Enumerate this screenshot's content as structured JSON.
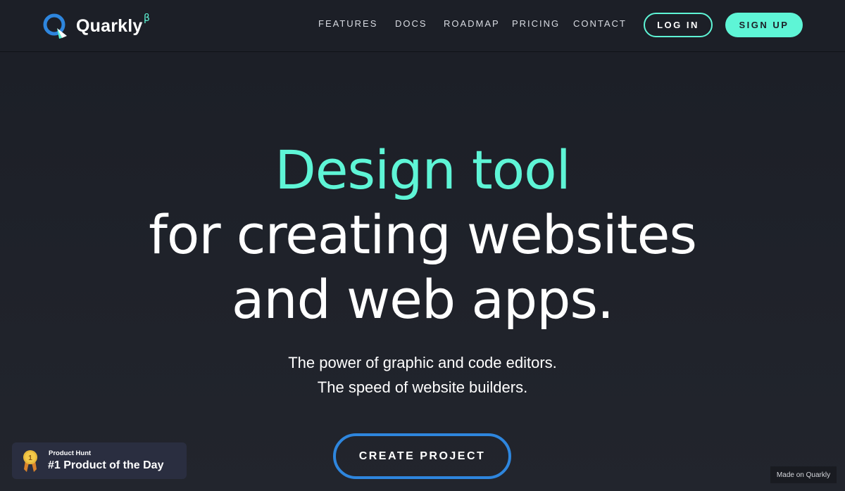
{
  "header": {
    "logo_text": "Quarkly",
    "logo_beta": "β",
    "nav": [
      "FEATURES",
      "DOCS",
      "ROADMAP",
      "PRICING",
      "CONTACT"
    ],
    "login_label": "LOG IN",
    "signup_label": "SIGN UP"
  },
  "hero": {
    "title_line1": "Design tool",
    "title_line2": "for creating websites",
    "title_line3": "and web apps.",
    "subtitle_line1": "The power of graphic and code editors.",
    "subtitle_line2": "The speed of website builders.",
    "cta_label": "CREATE PROJECT"
  },
  "product_hunt": {
    "small_label": "Product Hunt",
    "big_label": "#1 Product of the Day",
    "medal_number": "1"
  },
  "footer_badge": {
    "label": "Made on Quarkly"
  },
  "colors": {
    "accent": "#5ef5d6",
    "button_border": "#2e86de",
    "background": "#1c1f27",
    "logo_blue": "#2e86de"
  },
  "icons": {
    "logo": "quarkly-logo-icon",
    "medal": "gold-medal-icon"
  }
}
